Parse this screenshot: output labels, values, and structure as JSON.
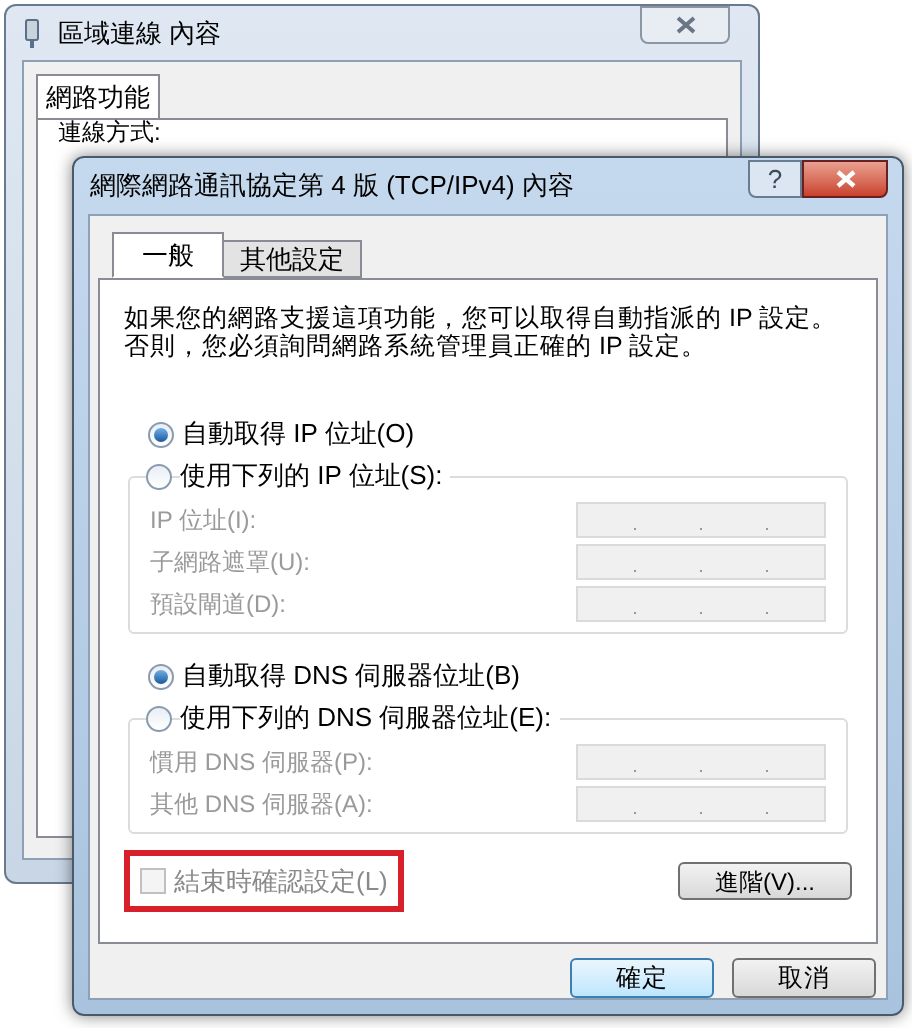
{
  "back_window": {
    "title": "區域連線 內容",
    "tabs": [
      {
        "label": "網路功能",
        "selected": true
      }
    ],
    "label": "連線方式:"
  },
  "window": {
    "title": "網際網路通訊協定第 4 版 (TCP/IPv4) 內容",
    "help": "?"
  },
  "tabs": [
    {
      "label": "一般",
      "selected": true
    },
    {
      "label": "其他設定",
      "selected": false
    }
  ],
  "description": "如果您的網路支援這項功能，您可以取得自動指派的 IP 設定。否則，您必須詢問網路系統管理員正確的 IP 設定。",
  "ip_group": {
    "options": [
      {
        "label": "自動取得 IP 位址(O)",
        "selected": true
      },
      {
        "label": "使用下列的 IP 位址(S):",
        "selected": false
      }
    ],
    "fields": [
      {
        "label": "IP 位址(I):",
        "disabled": true
      },
      {
        "label": "子網路遮罩(U):",
        "disabled": true
      },
      {
        "label": "預設閘道(D):",
        "disabled": true
      }
    ]
  },
  "dns_group": {
    "options": [
      {
        "label": "自動取得 DNS 伺服器位址(B)",
        "selected": true
      },
      {
        "label": "使用下列的 DNS 伺服器位址(E):",
        "selected": false
      }
    ],
    "fields": [
      {
        "label": "慣用 DNS 伺服器(P):",
        "disabled": true
      },
      {
        "label": "其他 DNS 伺服器(A):",
        "disabled": true
      }
    ]
  },
  "validate": {
    "label": "結束時確認設定(L)",
    "checked": false,
    "disabled": true,
    "highlighted": true
  },
  "advanced_button": "進階(V)...",
  "buttons": [
    {
      "label": "確定",
      "default": true
    },
    {
      "label": "取消",
      "default": false
    }
  ]
}
